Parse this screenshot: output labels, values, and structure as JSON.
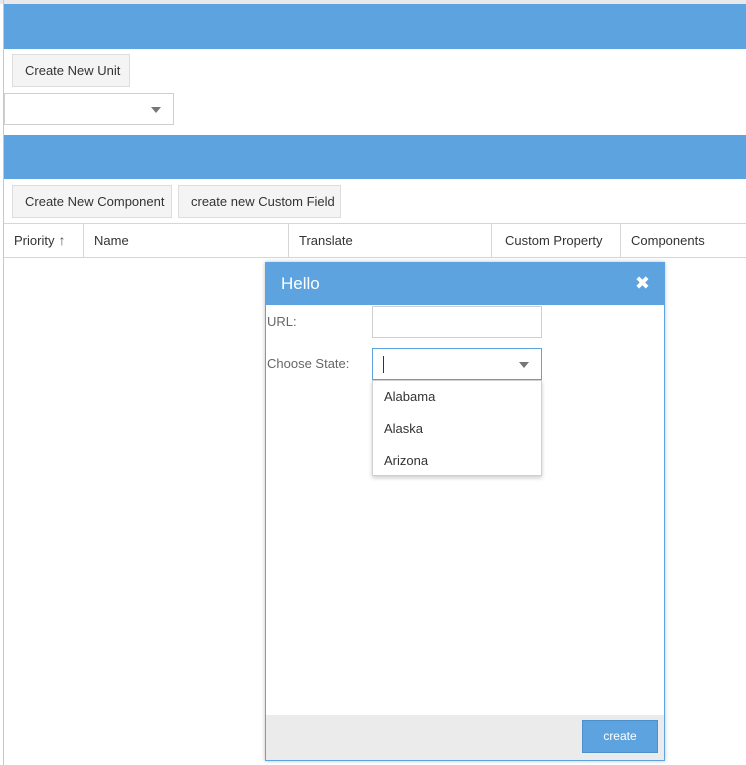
{
  "toolbar": {
    "create_unit_label": "Create New Unit",
    "create_component_label": "Create New Component",
    "create_custom_field_label": "create new Custom Field"
  },
  "unit_select": {
    "value": ""
  },
  "grid": {
    "columns": [
      "Priority",
      "Name",
      "Translate",
      "Custom Property",
      "Components"
    ],
    "sort_indicator": "↑"
  },
  "dialog": {
    "title": "Hello",
    "close_icon": "✖",
    "url_label": "URL:",
    "url_value": "",
    "state_label": "Choose State:",
    "state_value": "",
    "state_options": [
      "Alabama",
      "Alaska",
      "Arizona"
    ],
    "create_label": "create"
  },
  "colors": {
    "accent": "#5da3df"
  }
}
